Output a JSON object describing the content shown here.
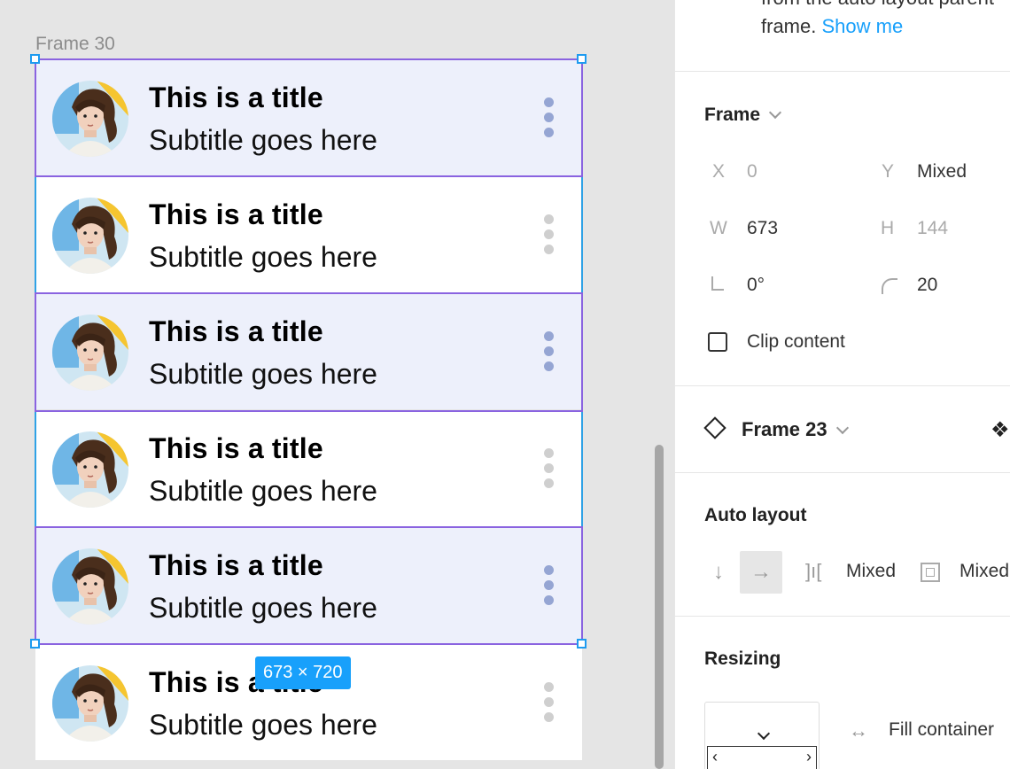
{
  "canvas": {
    "frame_label": "Frame 30",
    "size_badge": "673 × 720",
    "items": [
      {
        "title": "This is a title",
        "subtitle": "Subtitle goes here"
      },
      {
        "title": "This is a title",
        "subtitle": "Subtitle goes here"
      },
      {
        "title": "This is a title",
        "subtitle": "Subtitle goes here"
      },
      {
        "title": "This is a title",
        "subtitle": "Subtitle goes here"
      },
      {
        "title": "This is a title",
        "subtitle": "Subtitle goes here"
      },
      {
        "title": "This is a title",
        "subtitle": "Subtitle goes here"
      }
    ],
    "icons": {
      "avatar": "avatar-photo",
      "menu": "more-vertical-icon"
    },
    "colors": {
      "selection": "#8a63e0",
      "hover": "#2fa2e6",
      "badge": "#18a0fb",
      "selected_bg": "#edf0fb"
    }
  },
  "panel": {
    "hint_line1": "from the auto layout parent",
    "hint_line2_text": "frame.",
    "hint_link": "Show me",
    "frame": {
      "title": "Frame",
      "x_label": "X",
      "x_value": "0",
      "y_label": "Y",
      "y_value": "Mixed",
      "w_label": "W",
      "w_value": "673",
      "h_label": "H",
      "h_value": "144",
      "rotation_value": "0°",
      "radius_value": "20",
      "clip_label": "Clip content"
    },
    "component": {
      "name": "Frame 23",
      "icon": "component-instance-icon"
    },
    "auto_layout": {
      "title": "Auto layout",
      "spacing_value": "Mixed",
      "padding_value": "Mixed"
    },
    "resizing": {
      "title": "Resizing",
      "fill_label": "Fill container"
    }
  }
}
